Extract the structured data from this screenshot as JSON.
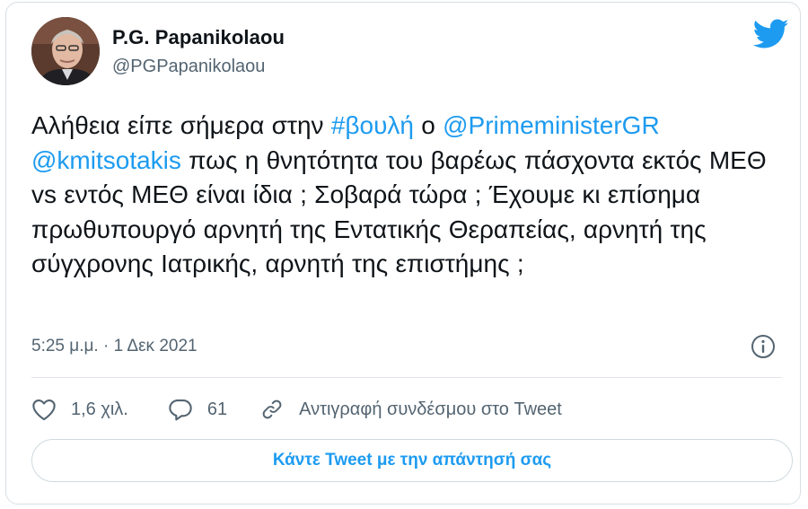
{
  "author": {
    "display_name": "P.G. Papanikolaou",
    "handle": "@PGPapanikolaou"
  },
  "tweet": {
    "line1_text": "Αλήθεια είπε σήμερα στην ",
    "hashtag": "#βουλή",
    "line1_mid": " ο ",
    "mention1": "@PrimeministerGR",
    "mention2": "@kmitsotakis",
    "body_rest": " πως η θνητότητα του βαρέως πάσχοντα εκτός ΜΕΘ vs εντός ΜΕΘ είναι ίδια ; Σοβαρά τώρα ; Έχουμε κι επίσημα πρωθυπουργό αρνητή της Εντατικής Θεραπείας, αρνητή της σύγχρονης Ιατρικής, αρνητή της επιστήμης ;",
    "timestamp": "5:25 μ.μ. · 1 Δεκ 2021"
  },
  "actions": {
    "likes": "1,6 χιλ.",
    "replies": "61",
    "copy_link": "Αντιγραφή συνδέσμου στο Tweet"
  },
  "reply_button": "Κάντε Tweet με την απάντησή σας",
  "icons": {
    "brand": "twitter-bird-icon",
    "info": "info-icon",
    "like": "heart-icon",
    "reply": "comment-icon",
    "link": "link-icon"
  },
  "colors": {
    "accent": "#1d9bf0",
    "text": "#0f1419",
    "muted": "#536471",
    "border": "#cfd9de"
  }
}
